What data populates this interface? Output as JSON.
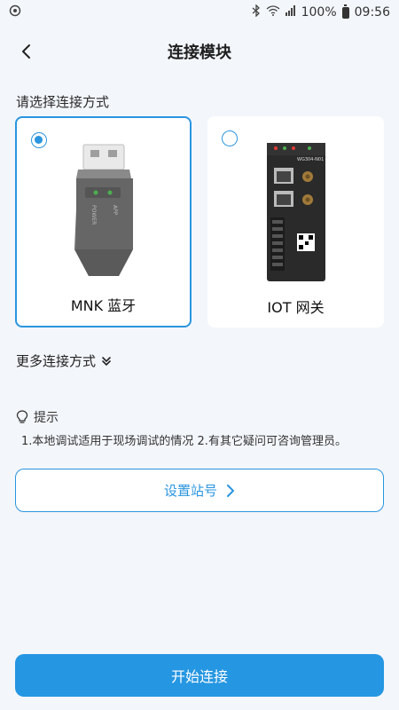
{
  "status_bar": {
    "battery": "100%",
    "time": "09:56"
  },
  "header": {
    "title": "连接模块"
  },
  "section": {
    "label": "请选择连接方式"
  },
  "options": [
    {
      "label": "MNK 蓝牙",
      "selected": true,
      "device_text_1": "POWER",
      "device_text_2": "APP"
    },
    {
      "label": "IOT 网关",
      "selected": false,
      "device_text": "WG304-N01"
    }
  ],
  "more": {
    "label": "更多连接方式"
  },
  "hint": {
    "title": "提示",
    "text": "1.本地调试适用于现场调试的情况 2.有其它疑问可咨询管理员。"
  },
  "station_button": {
    "label": "设置站号"
  },
  "start_button": {
    "label": "开始连接"
  },
  "colors": {
    "accent": "#2b95df",
    "background": "#f3f6fb"
  }
}
